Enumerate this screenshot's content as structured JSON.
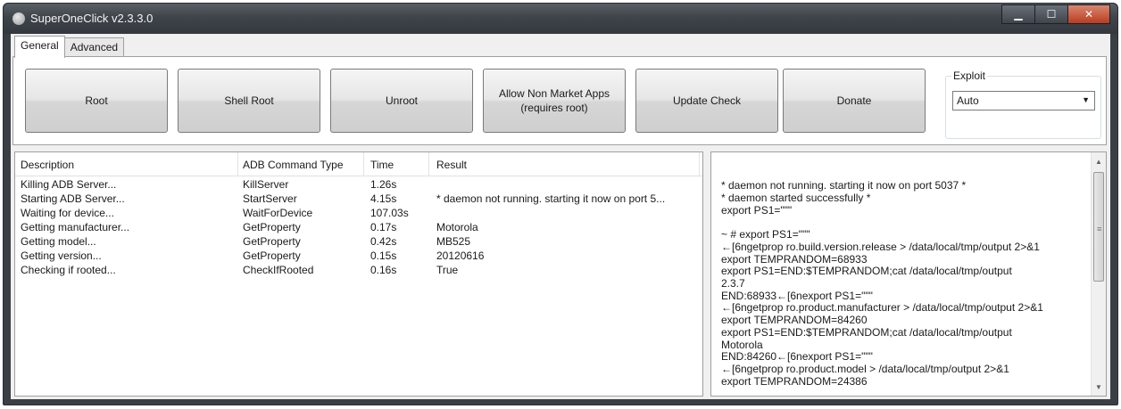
{
  "window": {
    "title": "SuperOneClick v2.3.3.0",
    "controls": {
      "minimize": "▁",
      "maximize": "☐",
      "close": "✕"
    }
  },
  "tabs": [
    {
      "label": "General",
      "active": true
    },
    {
      "label": "Advanced",
      "active": false
    }
  ],
  "toolbar": {
    "root": "Root",
    "shell_root": "Shell Root",
    "unroot": "Unroot",
    "allow_apps_line1": "Allow Non Market Apps",
    "allow_apps_line2": "(requires root)",
    "update_check": "Update Check",
    "donate": "Donate"
  },
  "exploit": {
    "label": "Exploit",
    "selected": "Auto"
  },
  "log": {
    "columns": [
      "Description",
      "ADB Command Type",
      "Time",
      "Result"
    ],
    "rows": [
      [
        "Killing ADB Server...",
        "KillServer",
        "1.26s",
        ""
      ],
      [
        "Starting ADB Server...",
        "StartServer",
        "4.15s",
        "* daemon not running. starting it now on port 5..."
      ],
      [
        "Waiting for device...",
        "WaitForDevice",
        "107.03s",
        ""
      ],
      [
        "Getting manufacturer...",
        "GetProperty",
        "0.17s",
        "Motorola"
      ],
      [
        "Getting model...",
        "GetProperty",
        "0.42s",
        "MB525"
      ],
      [
        "Getting version...",
        "GetProperty",
        "0.15s",
        "20120616"
      ],
      [
        "Checking if rooted...",
        "CheckIfRooted",
        "0.16s",
        "True"
      ]
    ]
  },
  "output": {
    "lines": [
      "* daemon not running. starting it now on port 5037 *",
      "* daemon started successfully *",
      "export PS1=\"\"\"",
      "",
      "~ # export PS1=\"\"\"",
      "←[6ngetprop ro.build.version.release > /data/local/tmp/output 2>&1",
      "export TEMPRANDOM=68933",
      "export PS1=END:$TEMPRANDOM;cat /data/local/tmp/output",
      "2.3.7",
      "END:68933←[6nexport PS1=\"\"\"",
      "←[6ngetprop ro.product.manufacturer > /data/local/tmp/output 2>&1",
      "export TEMPRANDOM=84260",
      "export PS1=END:$TEMPRANDOM;cat /data/local/tmp/output",
      "Motorola",
      "END:84260←[6nexport PS1=\"\"\"",
      "←[6ngetprop ro.product.model > /data/local/tmp/output 2>&1",
      "export TEMPRANDOM=24386"
    ]
  }
}
